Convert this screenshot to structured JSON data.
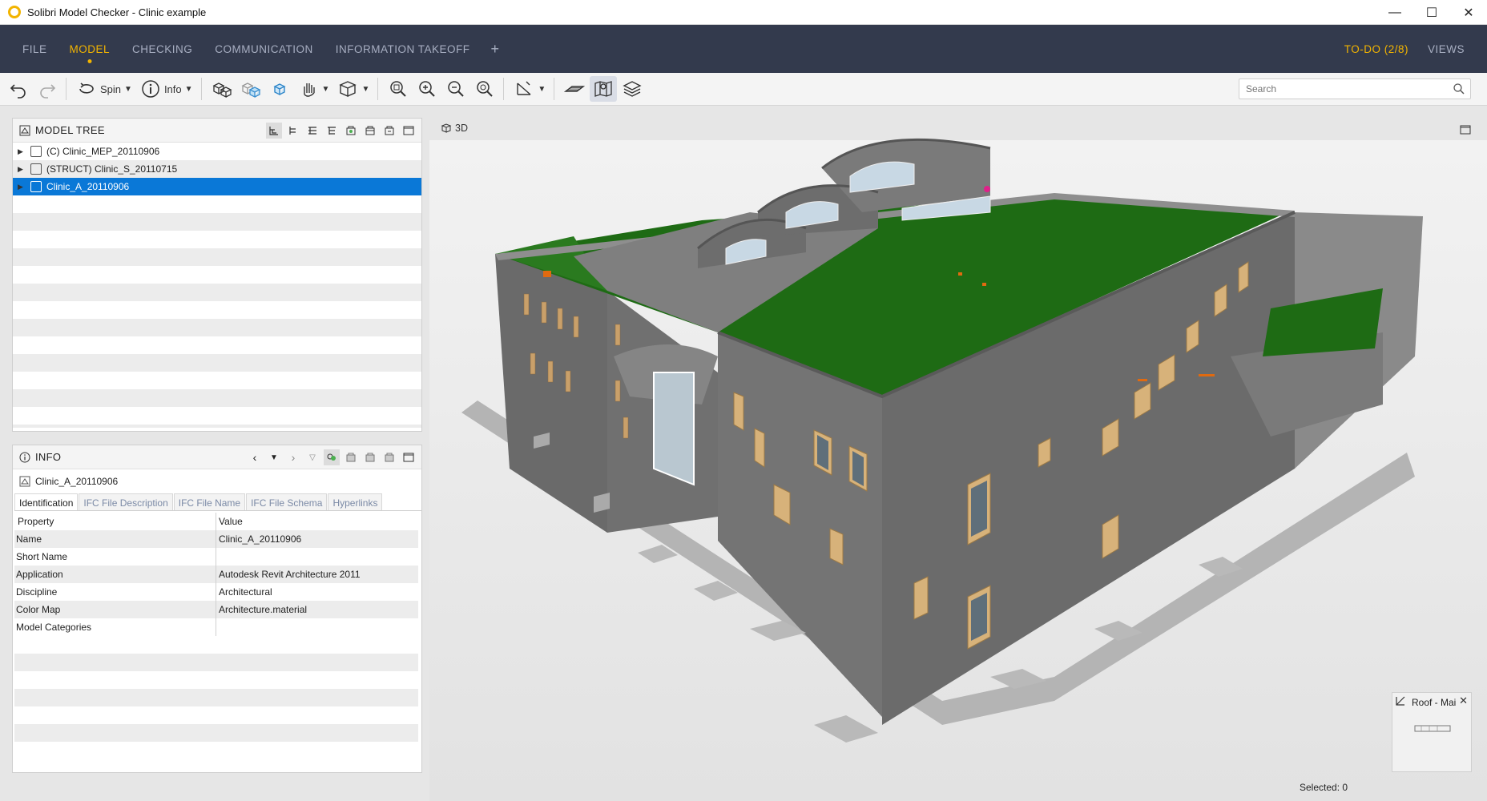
{
  "window": {
    "title": "Solibri Model Checker - Clinic example",
    "minimize": "—",
    "maximize": "☐",
    "close": "✕"
  },
  "menu": {
    "items": [
      "FILE",
      "MODEL",
      "CHECKING",
      "COMMUNICATION",
      "INFORMATION TAKEOFF"
    ],
    "active": "MODEL",
    "plus": "+",
    "todo": "TO-DO (2/8)",
    "views": "VIEWS"
  },
  "toolbar": {
    "spin_label": "Spin",
    "info_label": "Info",
    "search_placeholder": "Search"
  },
  "model_tree": {
    "title": "MODEL TREE",
    "items": [
      {
        "label": "(C) Clinic_MEP_20110906"
      },
      {
        "label": "(STRUCT) Clinic_S_20110715"
      },
      {
        "label": "Clinic_A_20110906",
        "selected": true
      }
    ]
  },
  "info": {
    "title": "INFO",
    "model_name": "Clinic_A_20110906",
    "tabs": [
      "Identification",
      "IFC File Description",
      "IFC File Name",
      "IFC File Schema",
      "Hyperlinks"
    ],
    "active_tab": "Identification",
    "columns": [
      "Property",
      "Value"
    ],
    "rows": [
      {
        "property": "Name",
        "value": "Clinic_A_20110906"
      },
      {
        "property": "Short Name",
        "value": ""
      },
      {
        "property": "Application",
        "value": "Autodesk Revit Architecture 2011"
      },
      {
        "property": "Discipline",
        "value": "Architectural"
      },
      {
        "property": "Color Map",
        "value": "Architecture.material"
      },
      {
        "property": "Model Categories",
        "value": ""
      }
    ]
  },
  "view": {
    "label": "3D",
    "minimap_label": "Roof - Mai",
    "selected": "Selected: 0"
  },
  "colors": {
    "menubar": "#333a4d",
    "accent": "#f2b400",
    "selection": "#0a78d7",
    "roof_green": "#1e6b14",
    "wall_gray": "#6e6e6e"
  }
}
